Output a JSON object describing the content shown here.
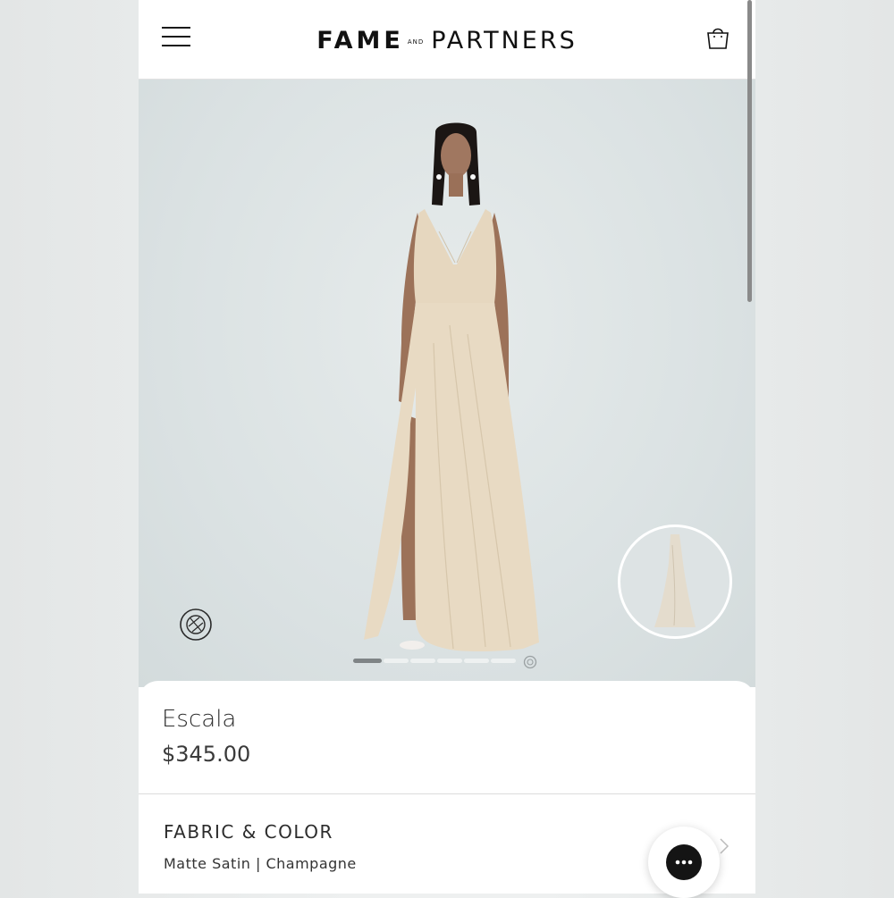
{
  "header": {
    "logo_fame": "FAME",
    "logo_and": "AND",
    "logo_partners": "PARTNERS",
    "menu_icon": "hamburger-menu-icon",
    "bag_icon": "shopping-bag-icon"
  },
  "gallery": {
    "camera_icon": "camera-aperture-icon",
    "pages_total": 6,
    "active_page": 1,
    "last_indicator_icon": "view-360-icon"
  },
  "product": {
    "name": "Escala",
    "price": "$345.00"
  },
  "fabric_color": {
    "label": "FABRIC & COLOR",
    "value": "Matte Satin | Champagne"
  },
  "chat": {
    "icon": "chat-bubble-icon"
  },
  "colors": {
    "dress": "#e6d7bf",
    "background": "#dbe2e3",
    "text": "#2d2d2d"
  }
}
